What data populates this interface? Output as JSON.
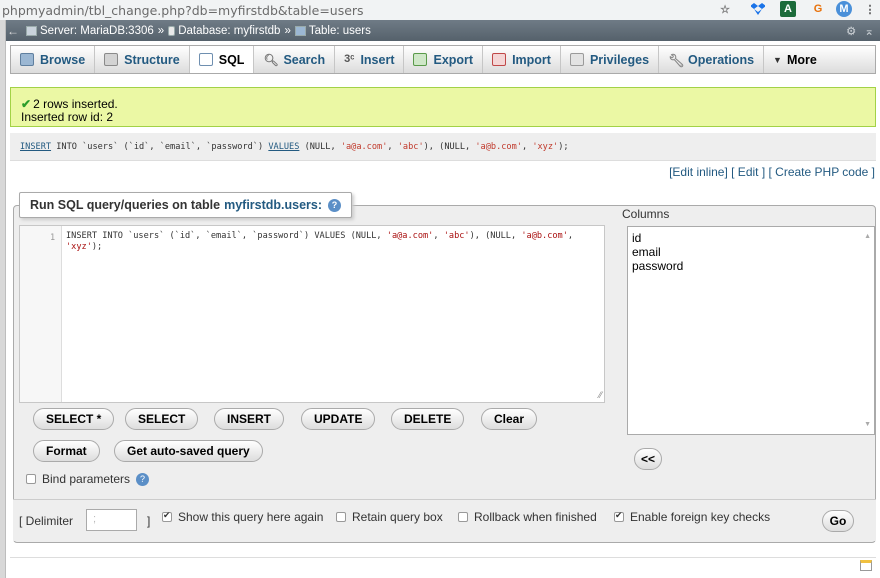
{
  "browser": {
    "url": "phpmyadmin/tbl_change.php?db=myfirstdb&table=users",
    "star": "☆",
    "ext_1": "",
    "ext_2": "A",
    "ext_3": "G",
    "profile": "M",
    "menu": "⋮"
  },
  "breadcrumb": {
    "back": "←",
    "server": "Server: MariaDB:3306",
    "database": "Database: myfirstdb",
    "table": "Table: users",
    "sep": "»"
  },
  "tabs": [
    {
      "label": "Browse",
      "icon": "browse-icon"
    },
    {
      "label": "Structure",
      "icon": "structure-icon"
    },
    {
      "label": "SQL",
      "icon": "sql-icon"
    },
    {
      "label": "Search",
      "icon": "search-icon"
    },
    {
      "label": "Insert",
      "icon": "insert-icon"
    },
    {
      "label": "Export",
      "icon": "export-icon"
    },
    {
      "label": "Import",
      "icon": "import-icon"
    },
    {
      "label": "Privileges",
      "icon": "privileges-icon"
    },
    {
      "label": "Operations",
      "icon": "operations-icon"
    },
    {
      "label": "More",
      "icon": "chevron-down-icon"
    }
  ],
  "message": {
    "line1": "2 rows inserted.",
    "line2": "Inserted row id: 2"
  },
  "query_echo": {
    "insert": "INSERT",
    "into_part": " INTO `users` (`id`, `email`, `password`) ",
    "values_kw": "VALUES",
    "open": " (NULL, ",
    "s1": "'a@a.com'",
    "c1": ", ",
    "s2": "'abc'",
    "mid": "), (NULL, ",
    "s3": "'a@b.com'",
    "c2": ", ",
    "s4": "'xyz'",
    "close": ");"
  },
  "links": {
    "edit_inline": "[Edit inline]",
    "edit": "[ Edit ]",
    "create_php": "[ Create PHP code ]"
  },
  "sql_box": {
    "legend_prefix": "Run SQL query/queries on table",
    "legend_table": "myfirstdb.users:",
    "line_number": "1",
    "code_line1_a": "INSERT INTO `users` (`id`, `email`, `password`) VALUES (NULL, ",
    "code_s1": "'a@a.com'",
    "code_c1": ", ",
    "code_s2": "'abc'",
    "code_mid": "), (NULL, ",
    "code_s3": "'a@b.com'",
    "code_c2": ",",
    "code_s4": "'xyz'",
    "code_close": ");"
  },
  "columns": {
    "label": "Columns",
    "items": [
      "id",
      "email",
      "password"
    ],
    "insert_button": "<<"
  },
  "buttons": {
    "select_star": "SELECT *",
    "select": "SELECT",
    "insert": "INSERT",
    "update": "UPDATE",
    "delete": "DELETE",
    "clear": "Clear",
    "format": "Format",
    "autosaved": "Get auto-saved query"
  },
  "bind_params": "Bind parameters",
  "options": {
    "delimiter_label": "[ Delimiter",
    "delimiter_value": ";",
    "delimiter_close": "]",
    "show_query": "Show this query here again",
    "retain": "Retain query box",
    "rollback": "Rollback when finished",
    "fk_checks": "Enable foreign key checks",
    "go": "Go"
  }
}
